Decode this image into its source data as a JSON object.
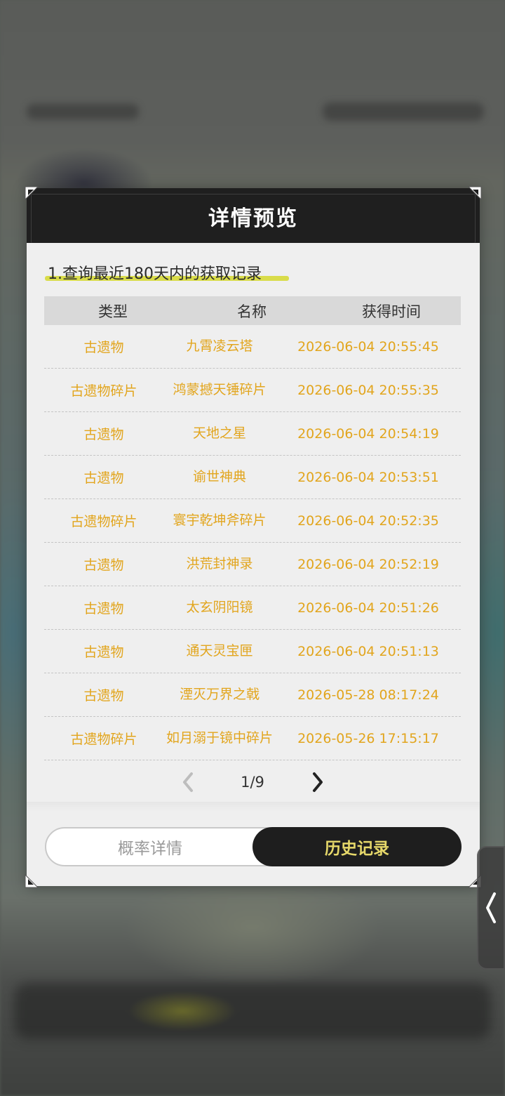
{
  "dialog": {
    "title": "详情预览",
    "notice": "1.查询最近180天内的获取记录"
  },
  "table": {
    "headers": [
      "类型",
      "名称",
      "获得时间"
    ],
    "rows": [
      {
        "type": "古遗物",
        "name": "九霄凌云塔",
        "time": "2026-06-04 20:55:45"
      },
      {
        "type": "古遗物碎片",
        "name": "鸿蒙撼天锤碎片",
        "time": "2026-06-04 20:55:35"
      },
      {
        "type": "古遗物",
        "name": "天地之星",
        "time": "2026-06-04 20:54:19"
      },
      {
        "type": "古遗物",
        "name": "谕世神典",
        "time": "2026-06-04 20:53:51"
      },
      {
        "type": "古遗物碎片",
        "name": "寰宇乾坤斧碎片",
        "time": "2026-06-04 20:52:35"
      },
      {
        "type": "古遗物",
        "name": "洪荒封神录",
        "time": "2026-06-04 20:52:19"
      },
      {
        "type": "古遗物",
        "name": "太玄阴阳镜",
        "time": "2026-06-04 20:51:26"
      },
      {
        "type": "古遗物",
        "name": "通天灵宝匣",
        "time": "2026-06-04 20:51:13"
      },
      {
        "type": "古遗物",
        "name": "湮灭万界之戟",
        "time": "2026-05-28 08:17:24"
      },
      {
        "type": "古遗物碎片",
        "name": "如月溺于镜中碎片",
        "time": "2026-05-26 17:15:17"
      }
    ]
  },
  "pager": {
    "page": "1/9"
  },
  "tabs": {
    "left": "概率详情",
    "right": "历史记录",
    "selected": "历史记录"
  },
  "colors": {
    "accent_text": "#e2a51d",
    "selected_tab_text": "#e6d86a",
    "highlight": "#d9dc4a",
    "header_bg": "#1f1f1f"
  },
  "icons": {
    "prev": "chevron-left-icon",
    "next": "chevron-right-icon",
    "side": "chevron-left-icon"
  }
}
